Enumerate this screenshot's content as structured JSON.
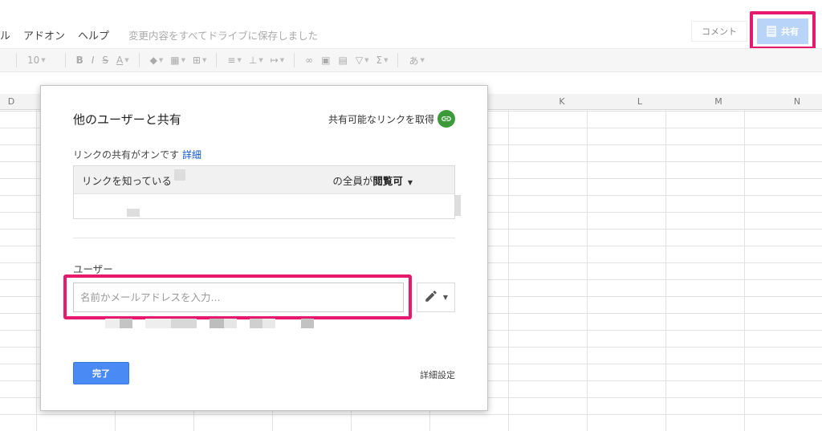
{
  "menubar": {
    "items": [
      "ル",
      "アドオン",
      "ヘルプ"
    ],
    "save_status": "変更内容をすべてドライブに保存しました"
  },
  "header": {
    "comment_label": "コメント",
    "share_label": "共有"
  },
  "toolbar": {
    "font_size": "10",
    "bold": "B",
    "italic": "I",
    "strike": "S",
    "text_color": "A",
    "sigma": "Σ",
    "input_tools": "あ"
  },
  "sheet": {
    "columns": [
      "D",
      "K",
      "L",
      "M",
      "N"
    ]
  },
  "dialog": {
    "title": "他のユーザーと共有",
    "get_link_label": "共有可能なリンクを取得",
    "link_status": "リンクの共有がオンです",
    "details_link": "詳細",
    "link_access_left": "リンクを知っている",
    "link_access_right_prefix": "の全員が",
    "link_access_right_bold": "閲覧可",
    "users_label": "ユーザー",
    "name_input": {
      "placeholder": "名前かメールアドレスを入力...",
      "value": ""
    },
    "done_label": "完了",
    "advanced_label": "詳細設定"
  },
  "colors": {
    "highlight": "#e6196e",
    "primary_button": "#4a8af4",
    "link_icon": "#3c9a3c",
    "share_button": "#b8d4f8"
  }
}
